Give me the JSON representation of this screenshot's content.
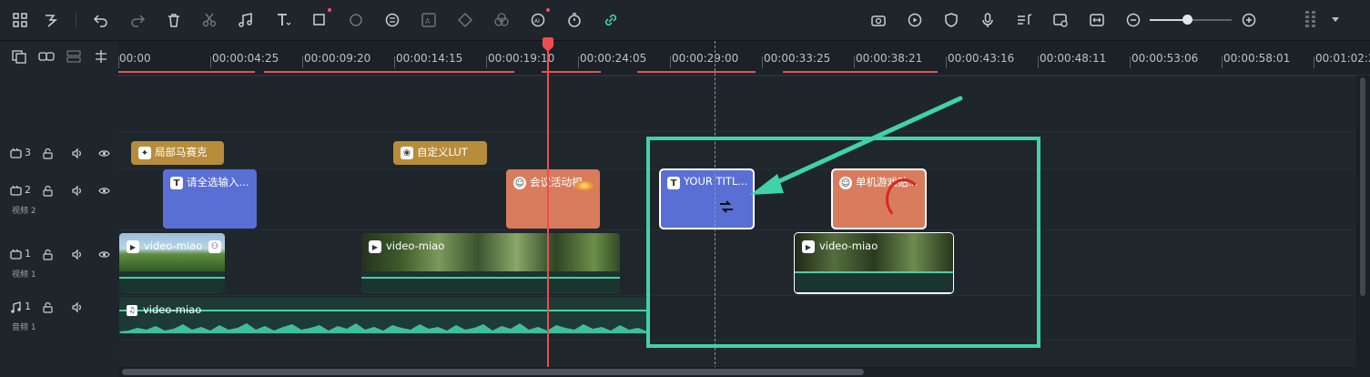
{
  "toolbar": {
    "left_icons": [
      "grid-layout-icon",
      "edit-tools-icon",
      "undo-icon",
      "redo-icon",
      "delete-icon",
      "cut-icon",
      "audio-icon",
      "text-icon",
      "crop-icon",
      "color-match-icon",
      "speed-icon",
      "ai-translate-icon",
      "keyframe-icon",
      "mask-icon",
      "ai-portrait-icon",
      "timer-icon",
      "link-icon"
    ],
    "right_icons": [
      "camera-plus-icon",
      "playback-icon",
      "shield-icon",
      "microphone-icon",
      "music-list-icon",
      "preview-render-icon",
      "fit-width-icon"
    ],
    "zoom_level": 0.45
  },
  "ruler": {
    "ticks": [
      "00:00",
      "00:00:04:25",
      "00:00:09:20",
      "00:00:14:15",
      "00:00:19:10",
      "00:00:24:05",
      "00:00:29:00",
      "00:00:33:25",
      "00:00:38:21",
      "00:00:43:16",
      "00:00:48:11",
      "00:00:53:06",
      "00:00:58:01",
      "00:01:02:26"
    ]
  },
  "tracks": [
    {
      "num": "3",
      "name": "",
      "type": "video"
    },
    {
      "num": "2",
      "name": "视频 2",
      "type": "video"
    },
    {
      "num": "1",
      "name": "视频 1",
      "type": "video"
    },
    {
      "num": "1",
      "name": "音频 1",
      "type": "audio"
    }
  ],
  "clips": {
    "mosaic": "局部马赛克",
    "lut": "自定义LUT",
    "text1": "请全选输入...",
    "meeting": "会议活动相...",
    "title": "YOUR TITL...",
    "game": "单机游戏贴...",
    "video_a": "video-miao",
    "video_b": "video-miao",
    "video_c": "video-miao",
    "audio": "video-miao"
  },
  "colors": {
    "accent_highlight": "#40d3a7",
    "playhead": "#ef4b52",
    "clip_blue": "#5a6fd6",
    "clip_orange": "#d97c5d",
    "clip_gold": "#b78c3a"
  }
}
